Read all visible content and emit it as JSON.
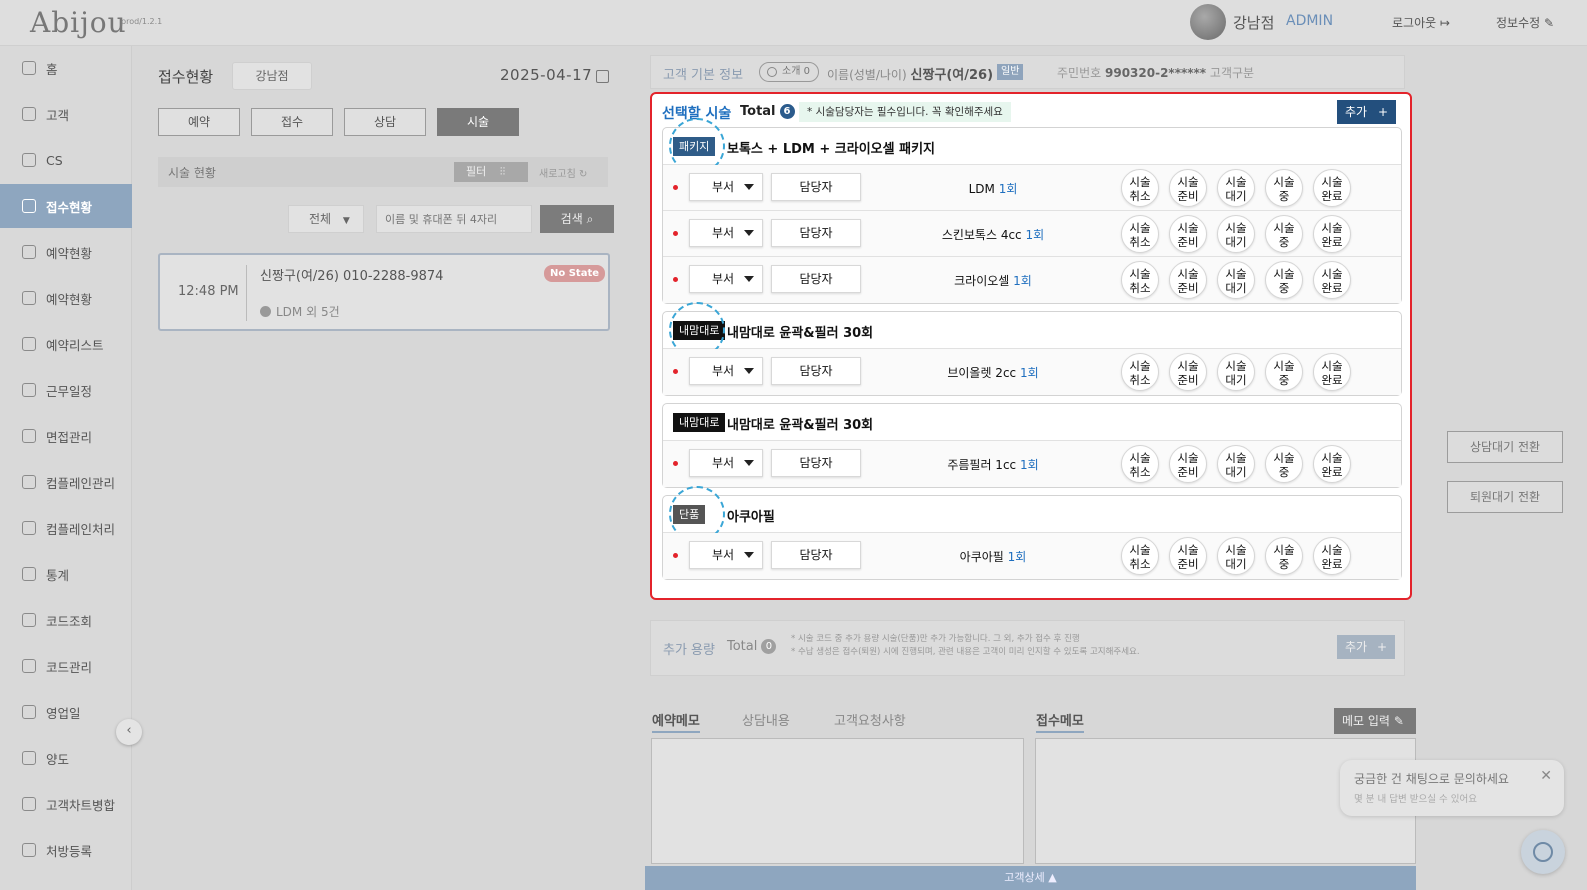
{
  "app": {
    "logo": "Abijou",
    "version": "prod/1.2.1"
  },
  "header": {
    "user_name": "강남점",
    "user_role": "ADMIN",
    "logout": "로그아웃",
    "edit_profile": "정보수정"
  },
  "sidebar": {
    "items": [
      {
        "label": "홈",
        "icon": "home-icon"
      },
      {
        "label": "고객",
        "icon": "users-icon"
      },
      {
        "label": "CS",
        "icon": "cs-icon"
      },
      {
        "label": "접수현황",
        "icon": "reception-icon",
        "active": true
      },
      {
        "label": "예약현황",
        "icon": "calendar-icon"
      },
      {
        "label": "예약현황",
        "icon": "calendar-icon"
      },
      {
        "label": "예약리스트",
        "icon": "list-icon"
      },
      {
        "label": "근무일정",
        "icon": "schedule-icon"
      },
      {
        "label": "면접관리",
        "icon": "interview-icon"
      },
      {
        "label": "컴플레인관리",
        "icon": "complain-icon"
      },
      {
        "label": "컴플레인처리",
        "icon": "complain-icon"
      },
      {
        "label": "통계",
        "icon": "chart-icon"
      },
      {
        "label": "코드조회",
        "icon": "code-icon"
      },
      {
        "label": "코드관리",
        "icon": "code-icon"
      },
      {
        "label": "영업일",
        "icon": "calendar-icon"
      },
      {
        "label": "양도",
        "icon": "transfer-icon"
      },
      {
        "label": "고객차트병합",
        "icon": "merge-icon"
      },
      {
        "label": "처방등록",
        "icon": "prescription-icon"
      }
    ],
    "collapse": "‹"
  },
  "left": {
    "title": "접수현황",
    "branch": "강남점",
    "date": "2025-04-17",
    "tabs": [
      "예약",
      "접수",
      "상담",
      "시술"
    ],
    "status_label": "시술 현황",
    "filter": "필터",
    "refresh": "새로고침",
    "select_all": "전체",
    "search_placeholder": "이름 및 휴대폰 뒤 4자리",
    "search_btn": "검색",
    "card": {
      "time": "12:48 PM",
      "name": "신짱구(여/26)  010-2288-9874",
      "tag": "No State",
      "sub": "LDM 외 5건"
    }
  },
  "customer": {
    "label": "고객 기본 정보",
    "intro": "소개 0",
    "info_prefix": "이름(성별/나이)",
    "name": "신짱구(여/26)",
    "grade": "일반",
    "rrn_label": "주민번호",
    "rrn": "990320-2******",
    "type_label": "고객구분"
  },
  "panel": {
    "title": "선택할 시술",
    "total_label": "Total",
    "total": "6",
    "note": "* 시술담당자는 필수입니다. 꼭 확인해주세요",
    "add": "추가",
    "plus": "+",
    "dept": "부서",
    "staff": "담당자",
    "status_buttons": [
      [
        "시술",
        "취소"
      ],
      [
        "시술",
        "준비"
      ],
      [
        "시술",
        "대기"
      ],
      [
        "시술",
        "중"
      ],
      [
        "시술",
        "완료"
      ]
    ],
    "groups": [
      {
        "badge": "패키지",
        "type": "pkg",
        "name": "보톡스 + LDM + 크라이오셀 패키지",
        "rows": [
          {
            "name": "LDM",
            "count": "1회"
          },
          {
            "name": "스킨보톡스 4cc",
            "count": "1회"
          },
          {
            "name": "크라이오셀",
            "count": "1회"
          }
        ]
      },
      {
        "badge": "내맘대로",
        "type": "own",
        "name": "내맘대로 윤곽&필러 30회",
        "rows": [
          {
            "name": "브이올렛 2cc",
            "count": "1회"
          }
        ]
      },
      {
        "badge": "내맘대로",
        "type": "own",
        "name": "내맘대로 윤곽&필러 30회",
        "rows": [
          {
            "name": "주름필러 1cc",
            "count": "1회"
          }
        ]
      },
      {
        "badge": "단품",
        "type": "single",
        "name": "아쿠아필",
        "rows": [
          {
            "name": "아쿠아필",
            "count": "1회"
          }
        ]
      }
    ]
  },
  "extra": {
    "label": "추가 용량",
    "total_label": "Total",
    "total": "0",
    "note1": "* 시술 코드 중 추가 용량 시술(단품)만 추가 가능합니다. 그 외, 추가 접수 후 진행",
    "note2": "* 수납 생성은 접수(퇴원) 시에 진행되며, 관련 내용은 고객이 미리 인지할 수 있도록 고지해주세요.",
    "add": "추가",
    "plus": "+"
  },
  "memo": {
    "tabs": [
      "예약메모",
      "상담내용",
      "고객요청사항"
    ],
    "reception_tab": "접수메모",
    "memo_btn": "메모 입력",
    "detail_bar": "고객상세 ▲"
  },
  "right_buttons": [
    "상담대기 전환",
    "퇴원대기 전환"
  ],
  "chat": {
    "title": "궁금한 건 채팅으로 문의하세요",
    "sub": "몇 분 내 답변 받으실 수 있어요",
    "close": "✕"
  }
}
